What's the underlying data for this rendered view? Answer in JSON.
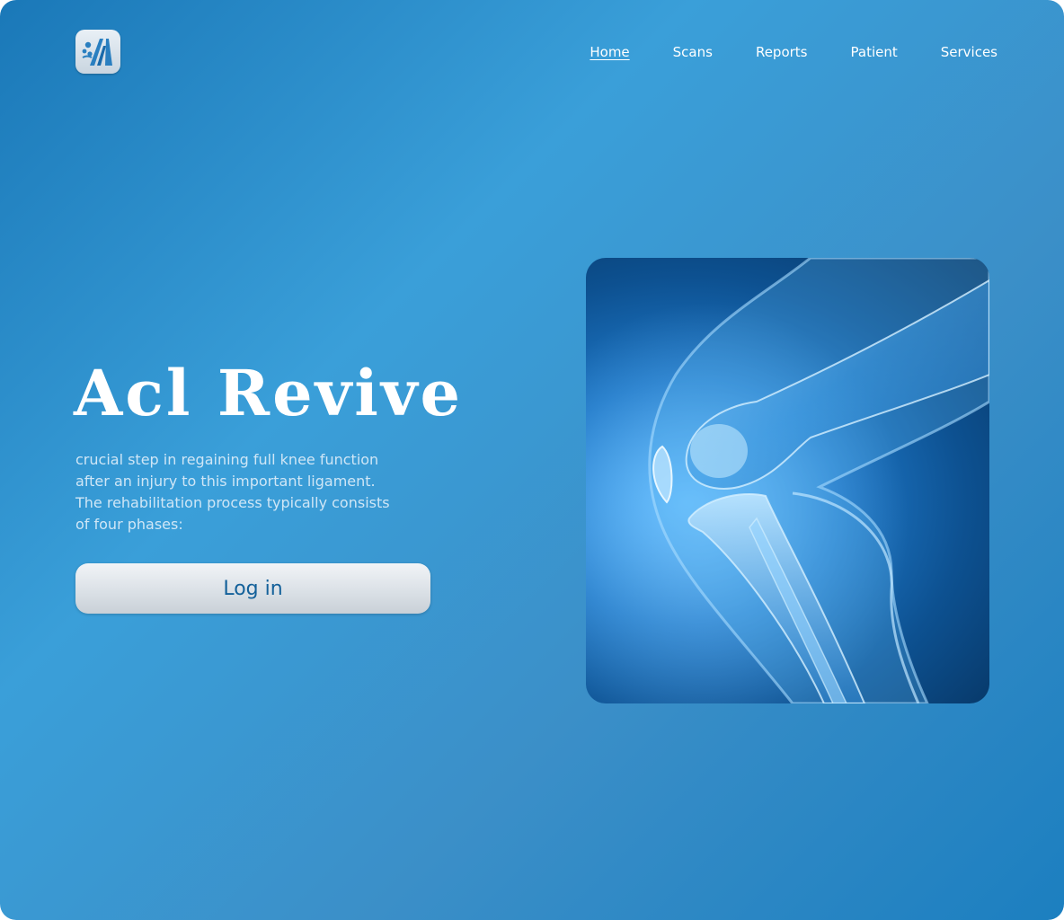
{
  "nav": {
    "items": [
      {
        "label": "Home",
        "active": true
      },
      {
        "label": "Scans",
        "active": false
      },
      {
        "label": "Reports",
        "active": false
      },
      {
        "label": "Patient",
        "active": false
      },
      {
        "label": "Services",
        "active": false
      }
    ]
  },
  "hero": {
    "title": "Acl Revive",
    "description": "crucial step in regaining full knee function after an injury to this important ligament. The rehabilitation process typically consists of four phases:",
    "login_label": "Log in"
  },
  "icons": {
    "logo": "acl-revive-logo-icon",
    "image": "knee-xray-illustration"
  },
  "colors": {
    "background_start": "#1a78b8",
    "background_mid": "#3a9fd9",
    "button_text": "#14619a",
    "description_text": "#cfe6f6"
  }
}
